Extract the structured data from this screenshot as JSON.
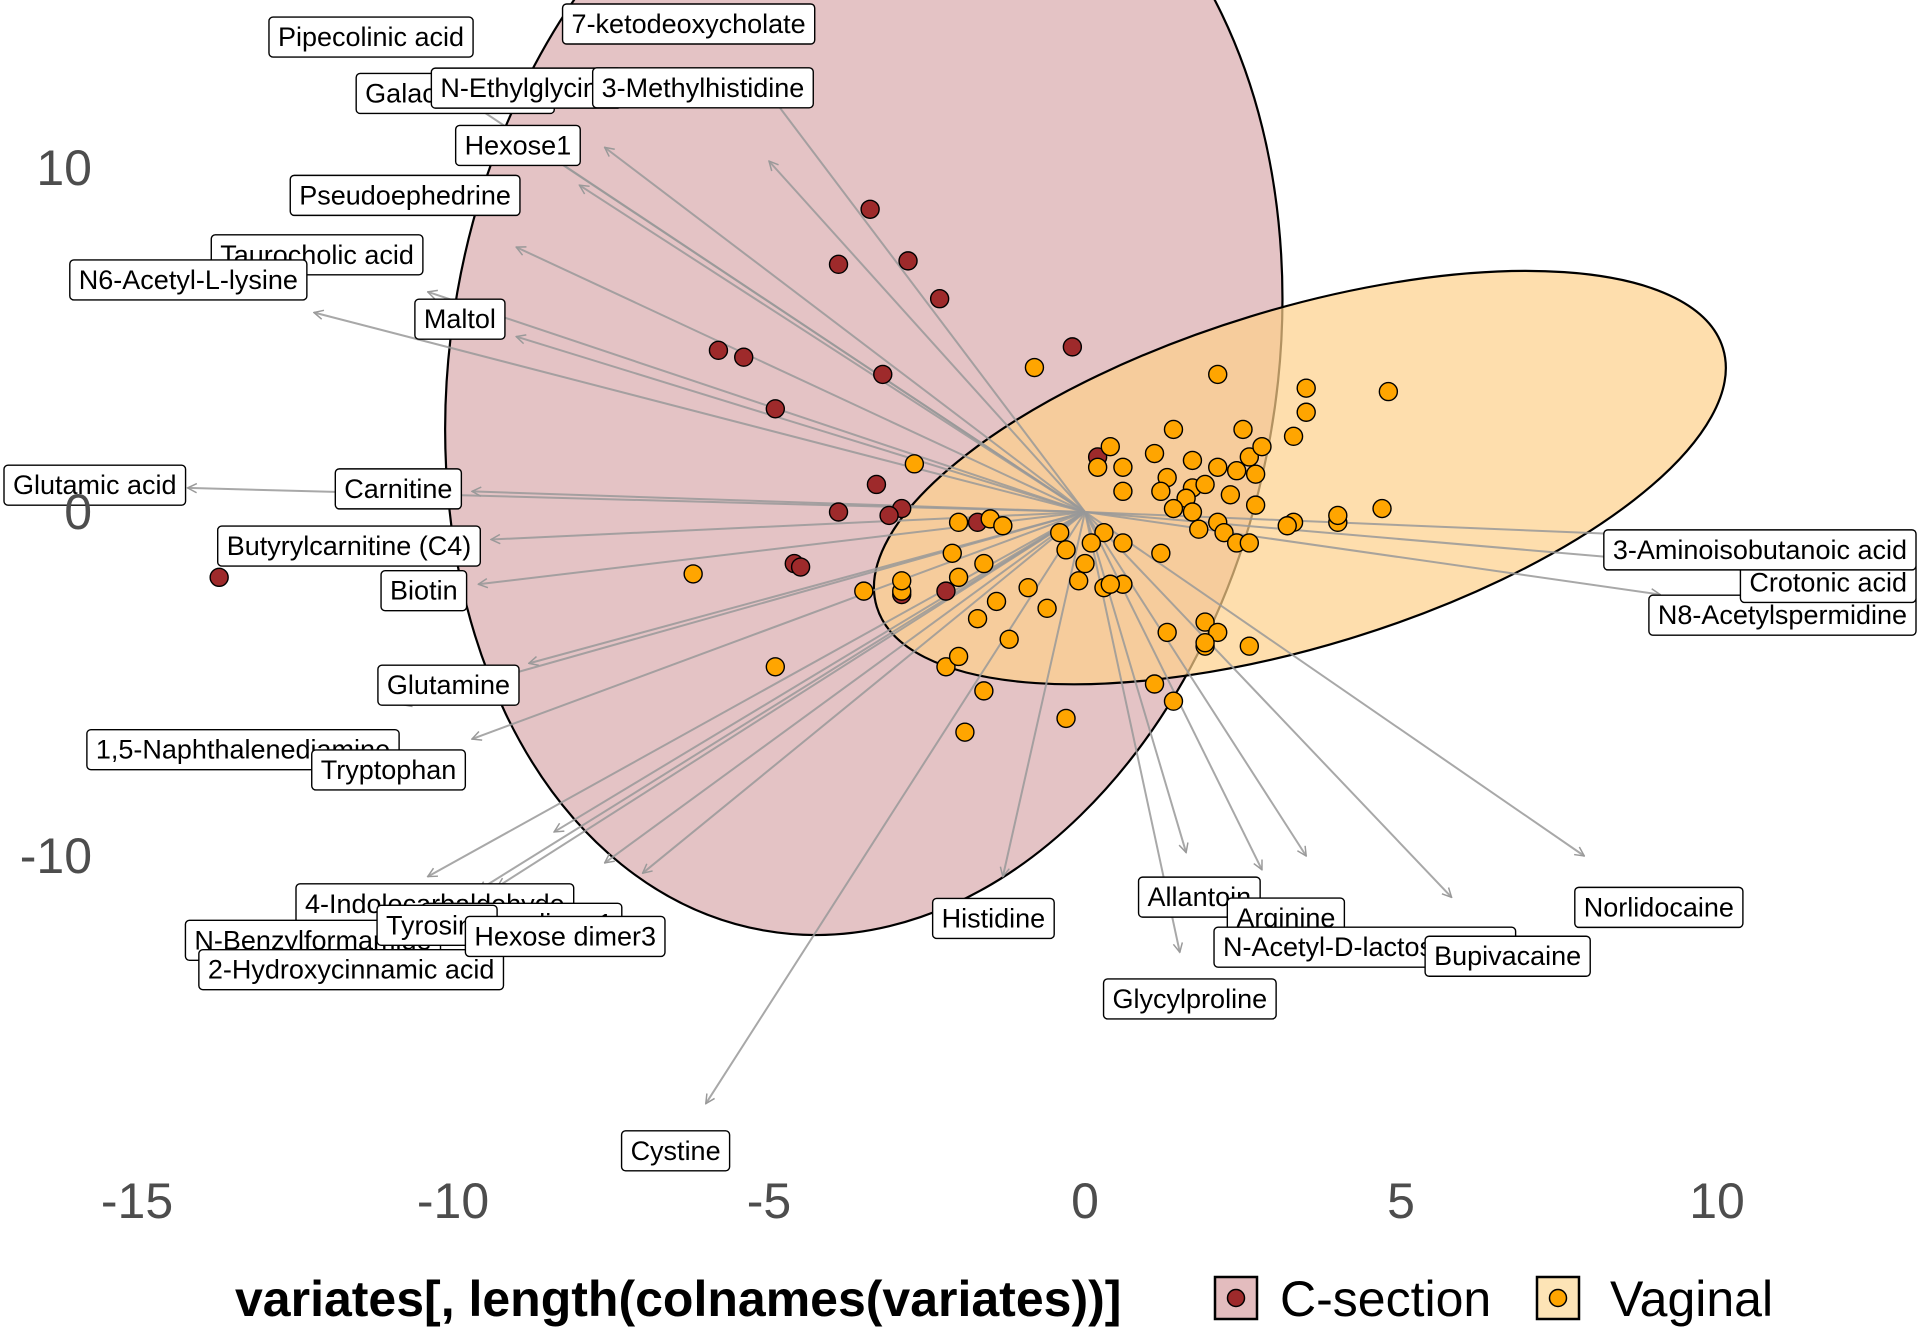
{
  "chart_data": {
    "type": "scatter",
    "subtype": "biplot",
    "xlim": [
      -15.5,
      13
    ],
    "ylim": [
      -16.5,
      14.5
    ],
    "x_ticks": [
      -15,
      -10,
      -5,
      0,
      5,
      10
    ],
    "y_ticks": [
      -10,
      0,
      10
    ],
    "x_tick_labels": [
      "-15",
      "-10",
      "-5",
      "0",
      "5",
      "10"
    ],
    "y_tick_labels": [
      "-10",
      "0",
      "10"
    ],
    "grid": false,
    "legend_position": "bottom",
    "legend_title": "variates[, length(colnames(variates))]",
    "groups": [
      {
        "name": "C-section",
        "point_color": "#9e2a2b",
        "ellipse_fill": "#d9a9ad",
        "ellipse_fill_opacity": 0.7,
        "legend_key_fill": "#e3bcbe",
        "ellipse": {
          "center": [
            -3.5,
            4.3
          ],
          "rx": 9.1,
          "ry": 12.0,
          "angle": -80
        },
        "points": [
          [
            -3.4,
            8.8
          ],
          [
            -3.9,
            7.2
          ],
          [
            -2.8,
            7.3
          ],
          [
            -2.3,
            6.2
          ],
          [
            -0.2,
            4.8
          ],
          [
            -5.8,
            4.7
          ],
          [
            -5.4,
            4.5
          ],
          [
            -3.2,
            4.0
          ],
          [
            -4.9,
            3.0
          ],
          [
            -3.3,
            0.8
          ],
          [
            -2.9,
            0.1
          ],
          [
            -3.1,
            -0.1
          ],
          [
            -3.9,
            0.0
          ],
          [
            -4.6,
            -1.5
          ],
          [
            -4.5,
            -1.6
          ],
          [
            -13.7,
            -1.9
          ],
          [
            0.2,
            1.6
          ],
          [
            -1.7,
            -0.3
          ],
          [
            -2.2,
            -2.3
          ],
          [
            -2.9,
            -2.4
          ]
        ]
      },
      {
        "name": "Vaginal",
        "point_color": "#ffa500",
        "ellipse_fill": "#fdd08a",
        "ellipse_fill_opacity": 0.7,
        "legend_key_fill": "#fde4b6",
        "ellipse": {
          "center": [
            3.4,
            1.0
          ],
          "rx": 7.0,
          "ry": 4.9,
          "angle": -17
        },
        "points": [
          [
            -0.8,
            4.2
          ],
          [
            2.1,
            4.0
          ],
          [
            3.5,
            3.6
          ],
          [
            4.8,
            3.5
          ],
          [
            3.5,
            2.9
          ],
          [
            1.4,
            2.4
          ],
          [
            2.5,
            2.4
          ],
          [
            3.3,
            2.2
          ],
          [
            0.4,
            1.9
          ],
          [
            1.1,
            1.7
          ],
          [
            1.7,
            1.5
          ],
          [
            2.6,
            1.6
          ],
          [
            2.8,
            1.9
          ],
          [
            0.2,
            1.3
          ],
          [
            0.6,
            1.3
          ],
          [
            1.3,
            1.0
          ],
          [
            2.1,
            1.3
          ],
          [
            2.4,
            1.2
          ],
          [
            2.7,
            1.1
          ],
          [
            1.7,
            0.7
          ],
          [
            0.6,
            0.6
          ],
          [
            1.2,
            0.6
          ],
          [
            1.9,
            0.8
          ],
          [
            1.6,
            0.4
          ],
          [
            1.4,
            0.1
          ],
          [
            2.3,
            0.5
          ],
          [
            2.7,
            0.2
          ],
          [
            1.7,
            0.0
          ],
          [
            2.1,
            -0.3
          ],
          [
            1.8,
            -0.5
          ],
          [
            4.0,
            -0.3
          ],
          [
            4.7,
            0.1
          ],
          [
            4.0,
            -0.1
          ],
          [
            3.3,
            -0.3
          ],
          [
            3.2,
            -0.4
          ],
          [
            2.2,
            -0.6
          ],
          [
            2.4,
            -0.9
          ],
          [
            2.6,
            -0.9
          ],
          [
            0.6,
            -0.9
          ],
          [
            1.2,
            -1.2
          ],
          [
            0.3,
            -0.6
          ],
          [
            0.1,
            -0.9
          ],
          [
            -0.4,
            -0.6
          ],
          [
            -0.3,
            -1.1
          ],
          [
            -0.1,
            -2.0
          ],
          [
            0.3,
            -2.2
          ],
          [
            0.6,
            -2.1
          ],
          [
            0.0,
            -1.5
          ],
          [
            0.4,
            -2.1
          ],
          [
            1.3,
            -3.5
          ],
          [
            1.9,
            -3.2
          ],
          [
            2.1,
            -3.5
          ],
          [
            2.6,
            -3.9
          ],
          [
            1.9,
            -3.9
          ],
          [
            1.9,
            -3.8
          ],
          [
            1.1,
            -5.0
          ],
          [
            1.4,
            -5.5
          ],
          [
            -0.3,
            -6.0
          ],
          [
            -1.9,
            -6.4
          ],
          [
            -1.6,
            -5.2
          ],
          [
            -2.2,
            -4.5
          ],
          [
            -2.0,
            -4.2
          ],
          [
            -1.2,
            -3.7
          ],
          [
            -0.6,
            -2.8
          ],
          [
            -1.7,
            -3.1
          ],
          [
            -1.4,
            -2.6
          ],
          [
            -2.0,
            -1.9
          ],
          [
            -2.1,
            -1.2
          ],
          [
            -1.6,
            -1.5
          ],
          [
            -1.5,
            -0.2
          ],
          [
            -1.3,
            -0.4
          ],
          [
            -2.0,
            -0.3
          ],
          [
            -2.7,
            1.4
          ],
          [
            -6.2,
            -1.8
          ],
          [
            -4.9,
            -4.5
          ],
          [
            -2.9,
            -2.3
          ],
          [
            -2.9,
            -2.0
          ],
          [
            -3.5,
            -2.3
          ],
          [
            -0.9,
            -2.2
          ]
        ]
      }
    ],
    "arrow_color": "#999999",
    "loadings": [
      {
        "name": "Pipecolinic acid",
        "tip": [
          -9.9,
          12.1
        ]
      },
      {
        "name": "7-ketodeoxycholate",
        "tip": [
          -5.3,
          12.9
        ]
      },
      {
        "name": "Galactosamine",
        "tip": [
          -8.6,
          10.5
        ]
      },
      {
        "name": "N-Ethylglycine",
        "tip": [
          -7.6,
          10.6
        ]
      },
      {
        "name": "3-Methylhistidine",
        "tip": [
          -5.0,
          10.2
        ]
      },
      {
        "name": "Hexose1",
        "tip": [
          -8.0,
          9.5
        ]
      },
      {
        "name": "Taurocholic acid",
        "tip": [
          -10.4,
          6.4
        ]
      },
      {
        "name": "Pseudoephedrine",
        "tip": [
          -9.0,
          7.7
        ]
      },
      {
        "name": "N6-Acetyl-L-lysine",
        "tip": [
          -12.2,
          5.8
        ]
      },
      {
        "name": "Maltol",
        "tip": [
          -9.0,
          5.1
        ]
      },
      {
        "name": "Carnitine",
        "tip": [
          -9.7,
          0.6
        ]
      },
      {
        "name": "Glutamic acid",
        "tip": [
          -14.2,
          0.7
        ]
      },
      {
        "name": "Butyrylcarnitine (C4)",
        "tip": [
          -9.4,
          -0.8
        ]
      },
      {
        "name": "Biotin",
        "tip": [
          -9.6,
          -2.1
        ]
      },
      {
        "name": "Glutamine",
        "tip": [
          -8.8,
          -4.4
        ]
      },
      {
        "name": "1,5-Naphthalenediamine",
        "tip": [
          -10.8,
          -5.6
        ]
      },
      {
        "name": "Tryptophan",
        "tip": [
          -9.7,
          -6.6
        ]
      },
      {
        "name": "4-Indolecarbaldehyde",
        "tip": [
          -8.4,
          -9.3
        ]
      },
      {
        "name": "N-Benzylformamide",
        "tip": [
          -10.4,
          -10.6
        ]
      },
      {
        "name": "Hexose dimer1",
        "tip": [
          -7.6,
          -10.2
        ]
      },
      {
        "name": "2-Hydroxycinnamic acid",
        "tip": [
          -9.6,
          -11.0
        ]
      },
      {
        "name": "Tyrosine",
        "tip": [
          -9.3,
          -10.9
        ]
      },
      {
        "name": "Hexose dimer3",
        "tip": [
          -7.0,
          -10.5
        ]
      },
      {
        "name": "Cystine",
        "tip": [
          -6.0,
          -17.2
        ]
      },
      {
        "name": "Histidine",
        "tip": [
          -1.3,
          -10.6
        ]
      },
      {
        "name": "Allantoin",
        "tip": [
          1.6,
          -9.9
        ]
      },
      {
        "name": "Glycylproline",
        "tip": [
          1.5,
          -12.8
        ]
      },
      {
        "name": "Arginine",
        "tip": [
          2.8,
          -10.4
        ]
      },
      {
        "name": "N-Acetyl-D-lactosamine",
        "tip": [
          3.5,
          -10.0
        ]
      },
      {
        "name": "Bupivacaine",
        "tip": [
          5.8,
          -11.2
        ]
      },
      {
        "name": "Norlidocaine",
        "tip": [
          7.9,
          -10.0
        ]
      },
      {
        "name": "N8-Acetylspermidine",
        "tip": [
          9.1,
          -2.4
        ]
      },
      {
        "name": "Crotonic acid",
        "tip": [
          11.4,
          -1.8
        ]
      },
      {
        "name": "3-Aminoisobutanoic acid",
        "tip": [
          11.8,
          -0.9
        ]
      }
    ]
  }
}
